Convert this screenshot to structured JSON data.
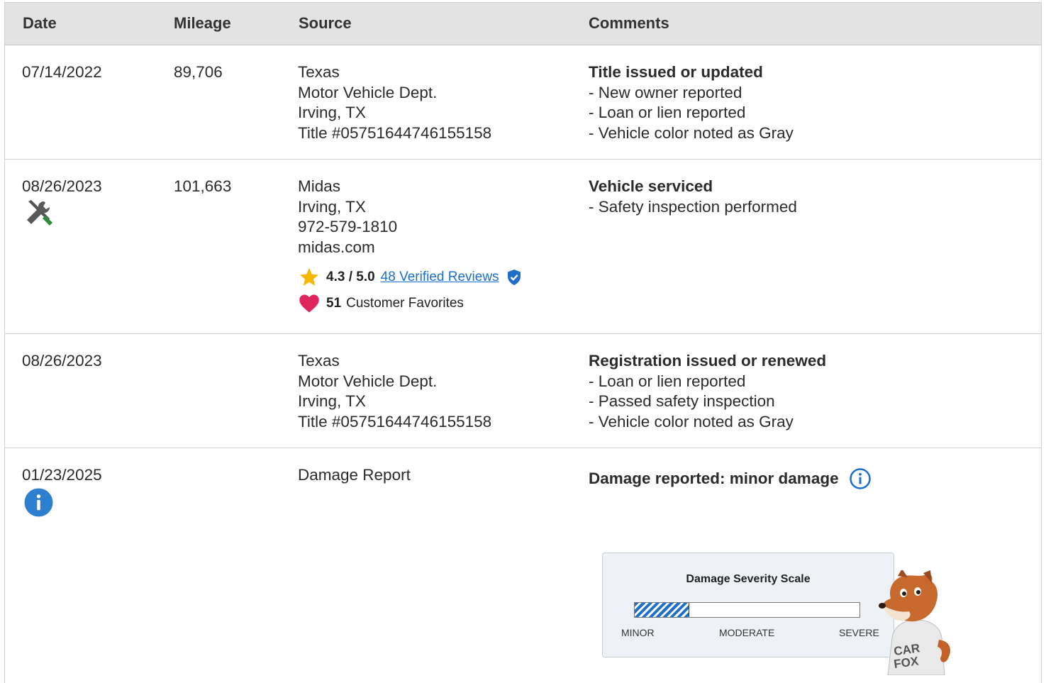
{
  "table": {
    "headers": [
      "Date",
      "Mileage",
      "Source",
      "Comments"
    ],
    "rows": [
      {
        "date": "07/14/2022",
        "mileage": "89,706",
        "source": [
          "Texas",
          "Motor Vehicle Dept.",
          "Irving, TX",
          "Title #05751644746155158"
        ],
        "comment_title": "Title issued or updated",
        "comment_items": [
          "- New owner reported",
          "- Loan or lien reported",
          "- Vehicle color noted as Gray"
        ]
      },
      {
        "date": "08/26/2023",
        "date_icon": "wrench-screwdriver-service-icon",
        "mileage": "101,663",
        "source": [
          "Midas",
          "Irving, TX",
          "972-579-1810",
          "midas.com"
        ],
        "rating": "4.3 / 5.0",
        "reviews_link": "48 Verified Reviews",
        "favorites_count": "51",
        "favorites_label": "Customer Favorites",
        "comment_title": "Vehicle serviced",
        "comment_items": [
          "- Safety inspection performed"
        ]
      },
      {
        "date": "08/26/2023",
        "mileage": "",
        "source": [
          "Texas",
          "Motor Vehicle Dept.",
          "Irving, TX",
          "Title #05751644746155158"
        ],
        "comment_title": "Registration issued or renewed",
        "comment_items": [
          "- Loan or lien reported",
          "- Passed safety inspection",
          "- Vehicle color noted as Gray"
        ]
      },
      {
        "date": "01/23/2025",
        "date_icon": "info-circle-icon",
        "mileage": "",
        "source": [
          "Damage Report"
        ],
        "comment_title": "Damage reported: minor damage",
        "comment_icon": "info-outline-icon"
      }
    ]
  },
  "damage_scale": {
    "title": "Damage Severity Scale",
    "labels": [
      "MINOR",
      "MODERATE",
      "SEVERE"
    ],
    "level_fraction": 0.24,
    "mascot_text": "CAR FOX"
  },
  "colors": {
    "header_bg": "#e3e3e3",
    "link": "#1a6fd0",
    "star": "#f5b800",
    "heart": "#e0245e",
    "info_blue": "#2f7fd0",
    "shield": "#1f6fc8",
    "bar_fill": "#1f6fc8"
  }
}
